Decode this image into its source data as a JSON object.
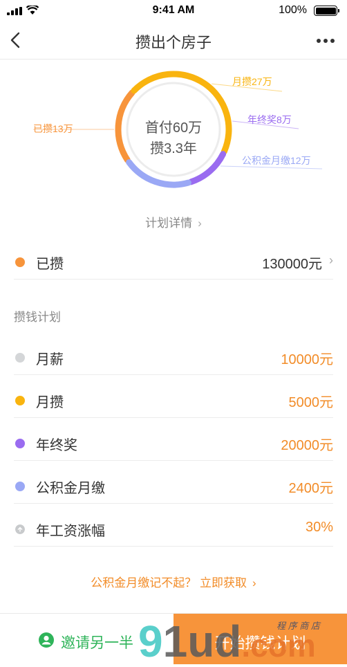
{
  "status_bar": {
    "time": "9:41 AM",
    "battery": "100%"
  },
  "nav": {
    "title": "攒出个房子"
  },
  "chart_data": {
    "type": "pie",
    "center_lines": [
      "首付60万",
      "攒3.3年"
    ],
    "segments": [
      {
        "label": "已攒13万",
        "value": 13,
        "color": "#f7943b"
      },
      {
        "label": "月攒27万",
        "value": 27,
        "color": "#f9b40f"
      },
      {
        "label": "年终奖8万",
        "value": 8,
        "color": "#9a6cf0"
      },
      {
        "label": "公积金月缴12万",
        "value": 12,
        "color": "#9aa8f5"
      }
    ]
  },
  "plan_detail": "计划详情",
  "saved": {
    "label": "已攒",
    "value": "130000元",
    "color": "#f7943b"
  },
  "section_title": "攒钱计划",
  "plan_items": [
    {
      "label": "月薪",
      "value": "10000元",
      "color": "#d4d6d8"
    },
    {
      "label": "月攒",
      "value": "5000元",
      "color": "#f9b40f"
    },
    {
      "label": "年终奖",
      "value": "20000元",
      "color": "#9a6cf0"
    },
    {
      "label": "公积金月缴",
      "value": "2400元",
      "color": "#9aa8f5"
    },
    {
      "label": "年工资涨幅",
      "value": "30%",
      "color": "#c8cacc",
      "icon": "up-arrow-icon"
    }
  ],
  "get_link": "公积金月缴记不起？ 立即获取",
  "bottom": {
    "invite": "邀请另一半",
    "start": "开始攒钱计划"
  },
  "watermark": {
    "main_a": "9",
    "main_b": "1ud",
    "main_c": ".com",
    "sub": "程 序 商 店"
  }
}
